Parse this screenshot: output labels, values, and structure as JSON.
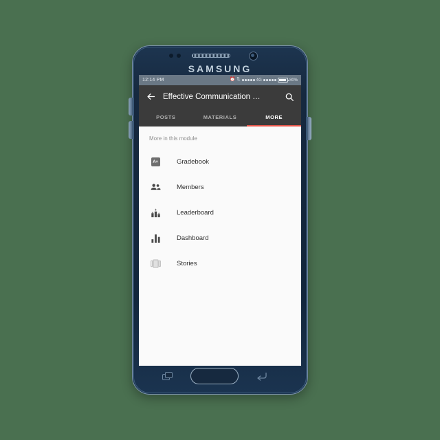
{
  "theme": {
    "page_background": "#4a7050",
    "device_body": "#16293f",
    "screen_background": "#fafafa",
    "app_bar": "#3b3b3b",
    "status_bar": "#6a7885",
    "accent": "#e8564a"
  },
  "device": {
    "brand": "SAMSUNG"
  },
  "status_bar": {
    "time": "12:14 PM",
    "network": "4G",
    "battery_percent": "80%",
    "icons": [
      "alarm-icon",
      "sync-icon",
      "signal-dots",
      "signal-dots-2",
      "battery-icon"
    ]
  },
  "app_bar": {
    "back_icon": "back-arrow-icon",
    "title": "Effective Communication …",
    "search_icon": "search-icon"
  },
  "tabs": [
    {
      "label": "POSTS",
      "active": false
    },
    {
      "label": "MATERIALS",
      "active": false
    },
    {
      "label": "MORE",
      "active": true
    }
  ],
  "content": {
    "section_header": "More in this module",
    "items": [
      {
        "label": "Gradebook",
        "icon": "gradebook-icon",
        "badge": "A+"
      },
      {
        "label": "Members",
        "icon": "members-icon"
      },
      {
        "label": "Leaderboard",
        "icon": "leaderboard-icon"
      },
      {
        "label": "Dashboard",
        "icon": "dashboard-icon"
      },
      {
        "label": "Stories",
        "icon": "stories-icon"
      }
    ]
  },
  "nav_buttons": {
    "recent": "recent-apps-button",
    "home": "home-button",
    "back": "back-button"
  }
}
